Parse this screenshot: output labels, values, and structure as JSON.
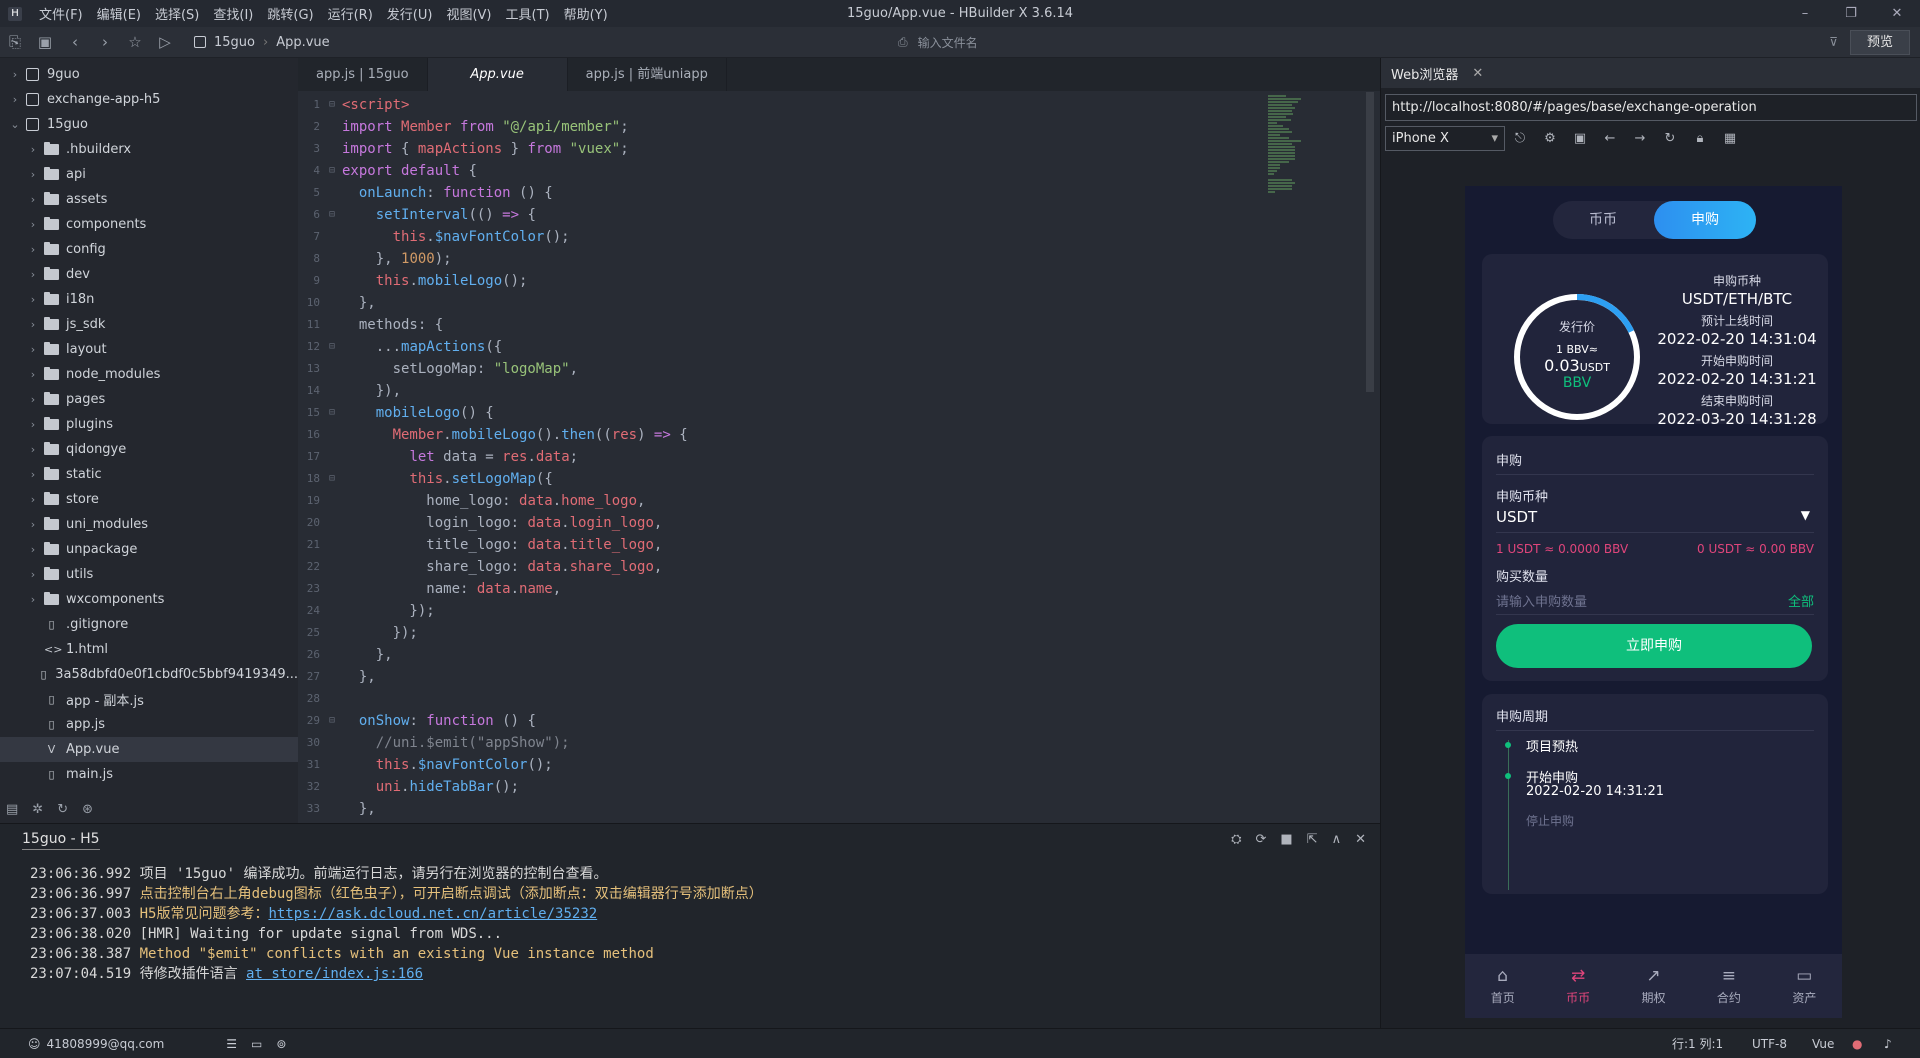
{
  "window": {
    "title": "15guo/App.vue - HBuilder X 3.6.14",
    "menus": [
      "文件(F)",
      "编辑(E)",
      "选择(S)",
      "查找(I)",
      "跳转(G)",
      "运行(R)",
      "发行(U)",
      "视图(V)",
      "工具(T)",
      "帮助(Y)"
    ],
    "controls": [
      "–",
      "❐",
      "✕"
    ]
  },
  "toolbar": {
    "breadcrumb_project": "15guo",
    "breadcrumb_file": "App.vue",
    "file_search_placeholder": "输入文件名",
    "preview_label": "预览"
  },
  "sidebar": {
    "items": [
      {
        "label": "9guo",
        "type": "project",
        "level": 0,
        "expanded": false
      },
      {
        "label": "exchange-app-h5",
        "type": "project",
        "level": 0,
        "expanded": false
      },
      {
        "label": "15guo",
        "type": "project",
        "level": 0,
        "expanded": true
      },
      {
        "label": ".hbuilderx",
        "type": "folder",
        "level": 1
      },
      {
        "label": "api",
        "type": "folder",
        "level": 1
      },
      {
        "label": "assets",
        "type": "folder",
        "level": 1
      },
      {
        "label": "components",
        "type": "folder",
        "level": 1
      },
      {
        "label": "config",
        "type": "folder",
        "level": 1
      },
      {
        "label": "dev",
        "type": "folder",
        "level": 1
      },
      {
        "label": "i18n",
        "type": "folder",
        "level": 1
      },
      {
        "label": "js_sdk",
        "type": "folder",
        "level": 1
      },
      {
        "label": "layout",
        "type": "folder",
        "level": 1
      },
      {
        "label": "node_modules",
        "type": "folder",
        "level": 1
      },
      {
        "label": "pages",
        "type": "folder",
        "level": 1
      },
      {
        "label": "plugins",
        "type": "folder",
        "level": 1
      },
      {
        "label": "qidongye",
        "type": "folder",
        "level": 1
      },
      {
        "label": "static",
        "type": "folder",
        "level": 1
      },
      {
        "label": "store",
        "type": "folder",
        "level": 1
      },
      {
        "label": "uni_modules",
        "type": "folder",
        "level": 1
      },
      {
        "label": "unpackage",
        "type": "folder",
        "level": 1
      },
      {
        "label": "utils",
        "type": "folder",
        "level": 1
      },
      {
        "label": "wxcomponents",
        "type": "folder",
        "level": 1
      },
      {
        "label": ".gitignore",
        "type": "file",
        "level": 1
      },
      {
        "label": "1.html",
        "type": "html",
        "level": 1
      },
      {
        "label": "3a58dbfd0e0f1cbdf0c5bbf9419349...",
        "type": "file",
        "level": 1
      },
      {
        "label": "app - 副本.js",
        "type": "file",
        "level": 1
      },
      {
        "label": "app.js",
        "type": "file",
        "level": 1
      },
      {
        "label": "App.vue",
        "type": "vue",
        "level": 1,
        "selected": true
      },
      {
        "label": "main.js",
        "type": "file",
        "level": 1
      }
    ]
  },
  "editor": {
    "tabs": [
      "app.js | 15guo",
      "App.vue",
      "app.js | 前端uniapp"
    ],
    "active_tab": 1,
    "lines": [
      [
        [
          "tg",
          "<script>"
        ]
      ],
      [
        [
          "kw",
          "import "
        ],
        [
          "vr",
          "Member "
        ],
        [
          "kw",
          "from "
        ],
        [
          "st",
          "\"@/api/member\""
        ],
        [
          "pl",
          ";"
        ]
      ],
      [
        [
          "kw",
          "import "
        ],
        [
          "pl",
          "{ "
        ],
        [
          "vr",
          "mapActions "
        ],
        [
          "pl",
          "} "
        ],
        [
          "kw",
          "from "
        ],
        [
          "st",
          "\"vuex\""
        ],
        [
          "pl",
          ";"
        ]
      ],
      [
        [
          "kw",
          "export default "
        ],
        [
          "pl",
          "{"
        ]
      ],
      [
        [
          "pl",
          "  "
        ],
        [
          "fn",
          "onLaunch"
        ],
        [
          "pl",
          ": "
        ],
        [
          "kw",
          "function "
        ],
        [
          "pl",
          "() {"
        ]
      ],
      [
        [
          "pl",
          "    "
        ],
        [
          "fn",
          "setInterval"
        ],
        [
          "pl",
          "(() "
        ],
        [
          "kw",
          "=> "
        ],
        [
          "pl",
          "{"
        ]
      ],
      [
        [
          "pl",
          "      "
        ],
        [
          "vr",
          "this"
        ],
        [
          "pl",
          "."
        ],
        [
          "fn",
          "$navFontColor"
        ],
        [
          "pl",
          "();"
        ]
      ],
      [
        [
          "pl",
          "    }, "
        ],
        [
          "nm",
          "1000"
        ],
        [
          "pl",
          ");"
        ]
      ],
      [
        [
          "pl",
          "    "
        ],
        [
          "vr",
          "this"
        ],
        [
          "pl",
          "."
        ],
        [
          "fn",
          "mobileLogo"
        ],
        [
          "pl",
          "();"
        ]
      ],
      [
        [
          "pl",
          "  },"
        ]
      ],
      [
        [
          "pl",
          "  methods: {"
        ]
      ],
      [
        [
          "pl",
          "    ..."
        ],
        [
          "fn",
          "mapActions"
        ],
        [
          "pl",
          "({"
        ]
      ],
      [
        [
          "pl",
          "      setLogoMap: "
        ],
        [
          "st",
          "\"logoMap\""
        ],
        [
          "pl",
          ","
        ]
      ],
      [
        [
          "pl",
          "    }),"
        ]
      ],
      [
        [
          "pl",
          "    "
        ],
        [
          "fn",
          "mobileLogo"
        ],
        [
          "pl",
          "() {"
        ]
      ],
      [
        [
          "pl",
          "      "
        ],
        [
          "vr",
          "Member"
        ],
        [
          "pl",
          "."
        ],
        [
          "fn",
          "mobileLogo"
        ],
        [
          "pl",
          "()."
        ],
        [
          "fn",
          "then"
        ],
        [
          "pl",
          "(("
        ],
        [
          "vr",
          "res"
        ],
        [
          "pl",
          ") "
        ],
        [
          "kw",
          "=> "
        ],
        [
          "pl",
          "{"
        ]
      ],
      [
        [
          "pl",
          "        "
        ],
        [
          "kw",
          "let "
        ],
        [
          "pl",
          "data = "
        ],
        [
          "vr",
          "res"
        ],
        [
          "pl",
          "."
        ],
        [
          "vr",
          "data"
        ],
        [
          "pl",
          ";"
        ]
      ],
      [
        [
          "pl",
          "        "
        ],
        [
          "vr",
          "this"
        ],
        [
          "pl",
          "."
        ],
        [
          "fn",
          "setLogoMap"
        ],
        [
          "pl",
          "({"
        ]
      ],
      [
        [
          "pl",
          "          home_logo: "
        ],
        [
          "vr",
          "data"
        ],
        [
          "pl",
          "."
        ],
        [
          "vr",
          "home_logo"
        ],
        [
          "pl",
          ","
        ]
      ],
      [
        [
          "pl",
          "          login_logo: "
        ],
        [
          "vr",
          "data"
        ],
        [
          "pl",
          "."
        ],
        [
          "vr",
          "login_logo"
        ],
        [
          "pl",
          ","
        ]
      ],
      [
        [
          "pl",
          "          title_logo: "
        ],
        [
          "vr",
          "data"
        ],
        [
          "pl",
          "."
        ],
        [
          "vr",
          "title_logo"
        ],
        [
          "pl",
          ","
        ]
      ],
      [
        [
          "pl",
          "          share_logo: "
        ],
        [
          "vr",
          "data"
        ],
        [
          "pl",
          "."
        ],
        [
          "vr",
          "share_logo"
        ],
        [
          "pl",
          ","
        ]
      ],
      [
        [
          "pl",
          "          name: "
        ],
        [
          "vr",
          "data"
        ],
        [
          "pl",
          "."
        ],
        [
          "vr",
          "name"
        ],
        [
          "pl",
          ","
        ]
      ],
      [
        [
          "pl",
          "        });"
        ]
      ],
      [
        [
          "pl",
          "      });"
        ]
      ],
      [
        [
          "pl",
          "    },"
        ]
      ],
      [
        [
          "pl",
          "  },"
        ]
      ],
      [
        [
          "pl",
          ""
        ]
      ],
      [
        [
          "pl",
          "  "
        ],
        [
          "fn",
          "onShow"
        ],
        [
          "pl",
          ": "
        ],
        [
          "kw",
          "function "
        ],
        [
          "pl",
          "() {"
        ]
      ],
      [
        [
          "cm",
          "    //uni.$emit(\"appShow\");"
        ]
      ],
      [
        [
          "pl",
          "    "
        ],
        [
          "vr",
          "this"
        ],
        [
          "pl",
          "."
        ],
        [
          "fn",
          "$navFontColor"
        ],
        [
          "pl",
          "();"
        ]
      ],
      [
        [
          "pl",
          "    "
        ],
        [
          "vr",
          "uni"
        ],
        [
          "pl",
          "."
        ],
        [
          "fn",
          "hideTabBar"
        ],
        [
          "pl",
          "();"
        ]
      ],
      [
        [
          "pl",
          "  },"
        ]
      ]
    ],
    "fold_lines": [
      1,
      4,
      6,
      12,
      15,
      18,
      29
    ]
  },
  "console": {
    "title": "15guo - H5",
    "lines": [
      {
        "time": "23:06:36.992",
        "text": "项目 '15guo' 编译成功。前端运行日志，请另行在浏览器的控制台查看。",
        "color": "cw"
      },
      {
        "time": "23:06:36.997",
        "text": "点击控制台右上角debug图标（红色虫子），可开启断点调试（添加断点：双击编辑器行号添加断点）",
        "color": "cy"
      },
      {
        "time": "23:06:37.003",
        "text": "H5版常见问题参考：",
        "color": "cy",
        "link": "https://ask.dcloud.net.cn/article/35232"
      },
      {
        "time": "23:06:38.020",
        "text": "[HMR] Waiting for update signal from WDS...",
        "color": "cw"
      },
      {
        "time": "23:06:38.387",
        "text": "Method \"$emit\" conflicts with an existing Vue instance method",
        "color": "cy"
      },
      {
        "time": "23:07:04.519",
        "text": "待修改插件语言  ",
        "color": "cw",
        "link": "at store/index.js:166"
      }
    ]
  },
  "status": {
    "account": "41808999@qq.com",
    "position": "行:1  列:1",
    "encoding": "UTF-8",
    "language": "Vue"
  },
  "browser": {
    "tab_label": "Web浏览器",
    "url": "http://localhost:8080/#/pages/base/exchange-operation",
    "device": "iPhone X"
  },
  "app": {
    "seg_left": "币币",
    "seg_right": "申购",
    "ring": {
      "title": "发行价",
      "rate": "1 BBV≈",
      "price": "0.03",
      "unit": "USDT",
      "token": "BBV",
      "progress_fraction": 0.18
    },
    "info": [
      {
        "label": "申购币种",
        "value": "USDT/ETH/BTC"
      },
      {
        "label": "预计上线时间",
        "value": "2022-02-20 14:31:04"
      },
      {
        "label": "开始申购时间",
        "value": "2022-02-20 14:31:21"
      },
      {
        "label": "结束申购时间",
        "value": "2022-03-20 14:31:28"
      }
    ],
    "form": {
      "section": "申购",
      "coin_label": "申购币种",
      "coin_value": "USDT",
      "rate_left": "1 USDT ≈ 0.0000 BBV",
      "rate_right": "0 USDT ≈ 0.00 BBV",
      "qty_label": "购买数量",
      "qty_placeholder": "请输入申购数量",
      "all_label": "全部",
      "buy_label": "立即申购"
    },
    "period": {
      "section": "申购周期",
      "step1": "项目预热",
      "step2": "开始申购",
      "step2_time": "2022-02-20 14:31:21",
      "step3": "停止申购"
    },
    "tabbar": [
      {
        "label": "首页",
        "icon": "⌂"
      },
      {
        "label": "币币",
        "icon": "⇄"
      },
      {
        "label": "期权",
        "icon": "↗"
      },
      {
        "label": "合约",
        "icon": "≡"
      },
      {
        "label": "资产",
        "icon": "▭"
      }
    ],
    "colors": {
      "accent": "#2d9ff2",
      "green": "#0fbf7c",
      "pink": "#e0457b",
      "red": "#e0457b"
    }
  }
}
